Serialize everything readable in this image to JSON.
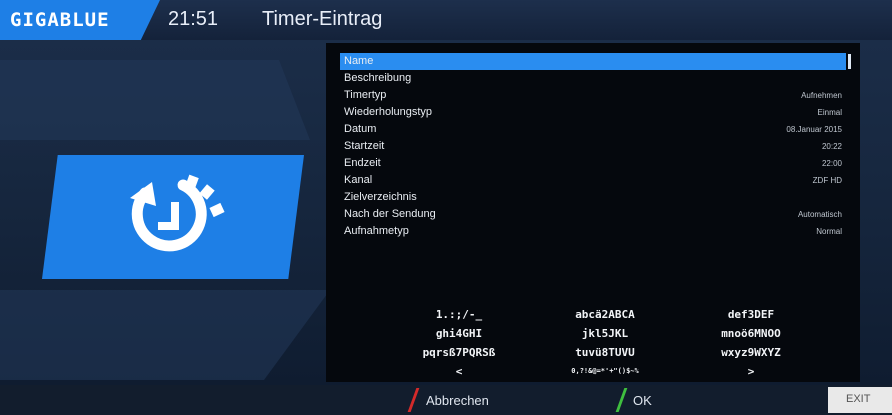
{
  "header": {
    "logo": "GIGABLUE",
    "clock": "21:51",
    "title": "Timer-Eintrag"
  },
  "list": [
    {
      "label": "Name",
      "value": "",
      "selected": true
    },
    {
      "label": "Beschreibung",
      "value": ""
    },
    {
      "label": "Timertyp",
      "value": "Aufnehmen"
    },
    {
      "label": "Wiederholungstyp",
      "value": "Einmal"
    },
    {
      "label": "Datum",
      "value": "08.Januar 2015"
    },
    {
      "label": "Startzeit",
      "value": "20:22"
    },
    {
      "label": "Endzeit",
      "value": "22:00"
    },
    {
      "label": "Kanal",
      "value": "ZDF HD"
    },
    {
      "label": "Zielverzeichnis",
      "value": ""
    },
    {
      "label": "Nach der Sendung",
      "value": "Automatisch"
    },
    {
      "label": "Aufnahmetyp",
      "value": "Normal"
    }
  ],
  "keypad": {
    "rows": [
      [
        "1.:;/-_",
        "abcä2ABCA",
        "def3DEF"
      ],
      [
        "ghi4GHI",
        "jkl5JKL",
        "mnoö6MNOO"
      ],
      [
        "pqrsß7PQRSß",
        "tuvü8TUVU",
        "wxyz9WXYZ"
      ],
      [
        "<",
        "0,?!&@=*'+\"()$~%",
        ">"
      ]
    ]
  },
  "footer": {
    "cancel_label": "Abbrechen",
    "ok_label": "OK",
    "exit_label": "EXIT"
  },
  "colors": {
    "accent_blue": "#1e7fe6",
    "red_key": "#d42a2a",
    "green_key": "#3fbf3f"
  },
  "icons": {
    "main": "timer-icon"
  }
}
